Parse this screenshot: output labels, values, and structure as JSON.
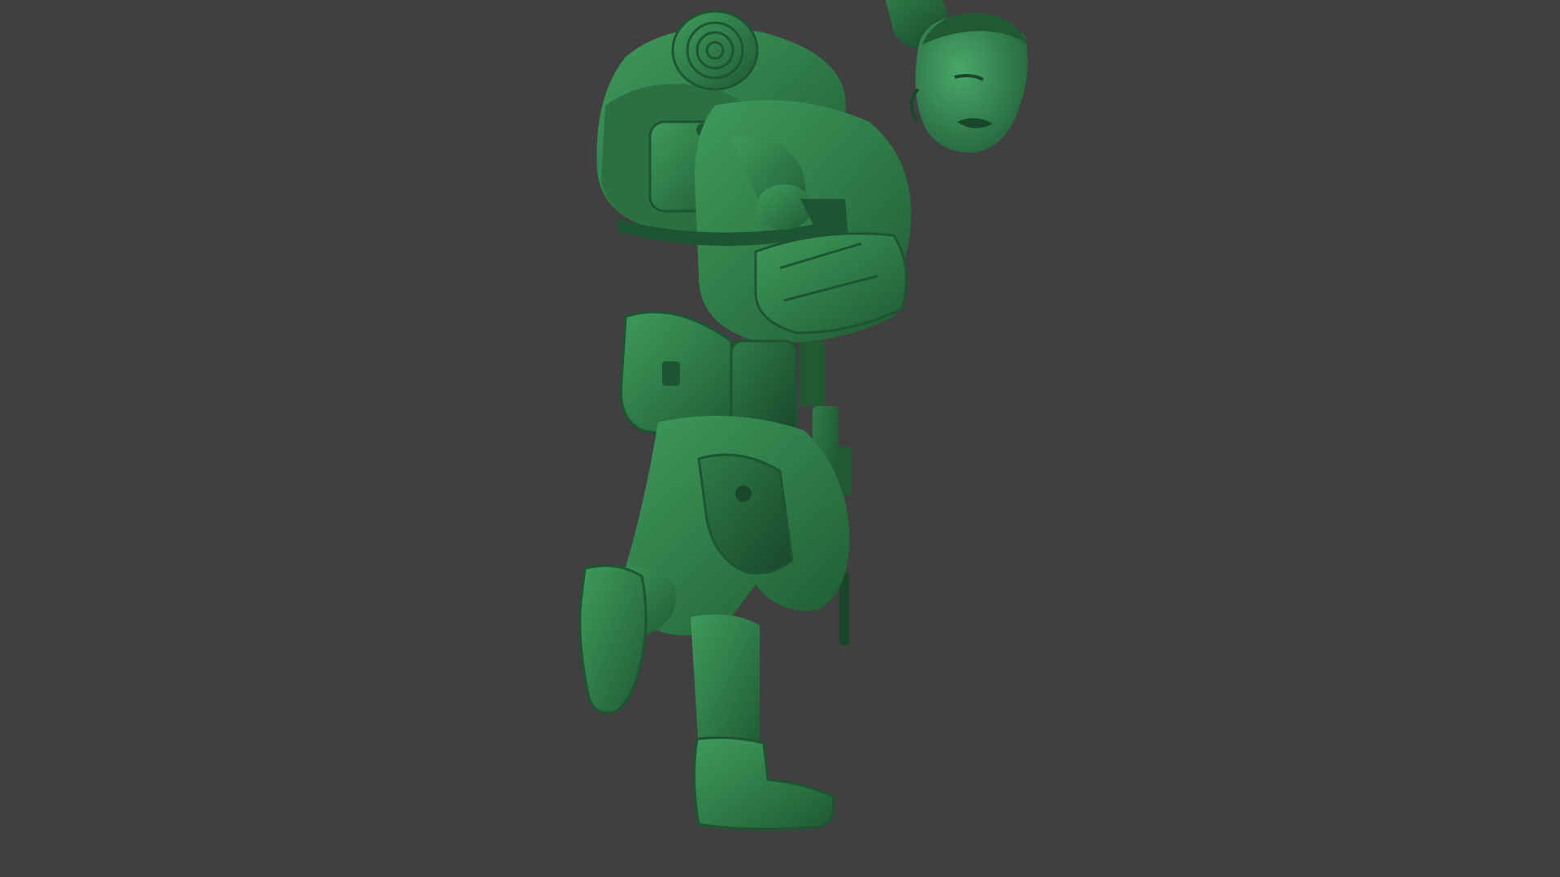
{
  "viewport": {
    "background_color": "#404040",
    "subject": "toy-soldier-sculpt",
    "material_color": "#2e7a45"
  }
}
